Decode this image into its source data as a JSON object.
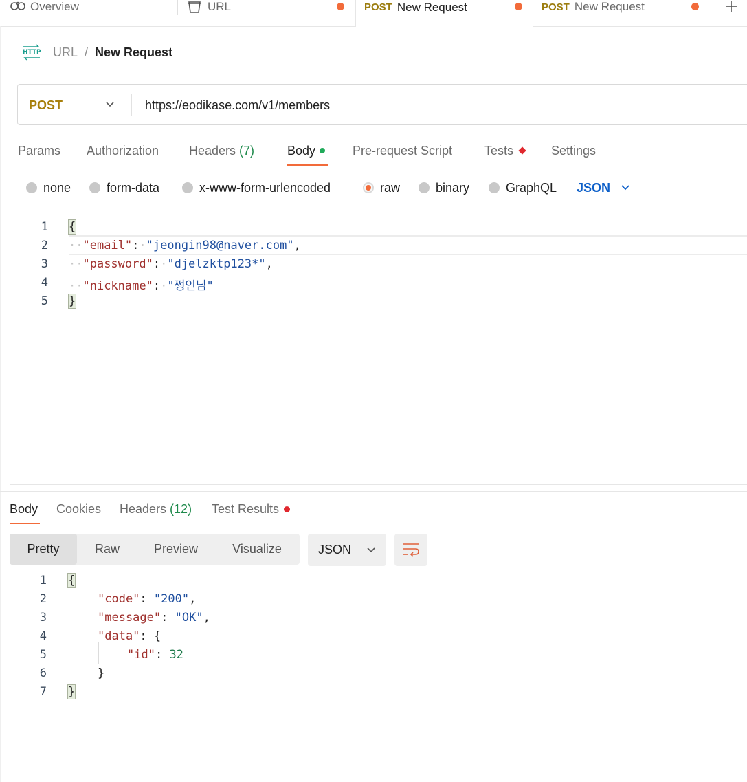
{
  "tabs": [
    {
      "method": "",
      "label": "Overview",
      "icon": "overview-icon",
      "unsaved": false
    },
    {
      "method": "",
      "label": "URL",
      "icon": "collection-icon",
      "unsaved": true
    },
    {
      "method": "POST",
      "label": "New Request",
      "icon": "",
      "unsaved": true,
      "active": true
    },
    {
      "method": "POST",
      "label": "New Request",
      "icon": "",
      "unsaved": true
    }
  ],
  "new_tab_label": "+",
  "breadcrumb": {
    "protocol_icon": "HTTP",
    "collection": "URL",
    "separator": "/",
    "request": "New Request"
  },
  "request": {
    "method": "POST",
    "url": "https://eodikase.com/v1/members"
  },
  "request_tabs": [
    {
      "label": "Params"
    },
    {
      "label": "Authorization"
    },
    {
      "label": "Headers",
      "count": "(7)"
    },
    {
      "label": "Body",
      "indicator": "green-dot"
    },
    {
      "label": "Pre-request Script"
    },
    {
      "label": "Tests",
      "indicator": "red-diamond"
    },
    {
      "label": "Settings"
    }
  ],
  "body_types": [
    "none",
    "form-data",
    "x-www-form-urlencoded",
    "raw",
    "binary",
    "GraphQL"
  ],
  "body_type_selected": "raw",
  "body_format": "JSON",
  "request_body": {
    "line_numbers": [
      "1",
      "2",
      "3",
      "4",
      "5"
    ],
    "open_brace": "{",
    "close_brace": "}",
    "entries": [
      {
        "key": "\"email\"",
        "value": "\"jeongin98@naver.com\"",
        "comma": ","
      },
      {
        "key": "\"password\"",
        "value": "\"djelzktp123*\"",
        "comma": ","
      },
      {
        "key": "\"nickname\"",
        "value": "\"쩡인님\"",
        "comma": ""
      }
    ]
  },
  "response_tabs": [
    {
      "label": "Body"
    },
    {
      "label": "Cookies"
    },
    {
      "label": "Headers",
      "count": "(12)"
    },
    {
      "label": "Test Results",
      "indicator": "red-dot"
    }
  ],
  "response_views": [
    "Pretty",
    "Raw",
    "Preview",
    "Visualize"
  ],
  "response_view_selected": "Pretty",
  "response_format": "JSON",
  "response_body": {
    "line_numbers": [
      "1",
      "2",
      "3",
      "4",
      "5",
      "6",
      "7"
    ],
    "open_brace": "{",
    "close_brace": "}",
    "code_key": "\"code\"",
    "code_value": "\"200\"",
    "message_key": "\"message\"",
    "message_value": "\"OK\"",
    "data_key": "\"data\"",
    "data_open": "{",
    "id_key": "\"id\"",
    "id_value": "32",
    "data_close": "}"
  },
  "colors": {
    "accent": "#f26b3a",
    "post_method": "#a8800c",
    "json_link": "#0e60c9",
    "count_green": "#1f8a4c"
  }
}
